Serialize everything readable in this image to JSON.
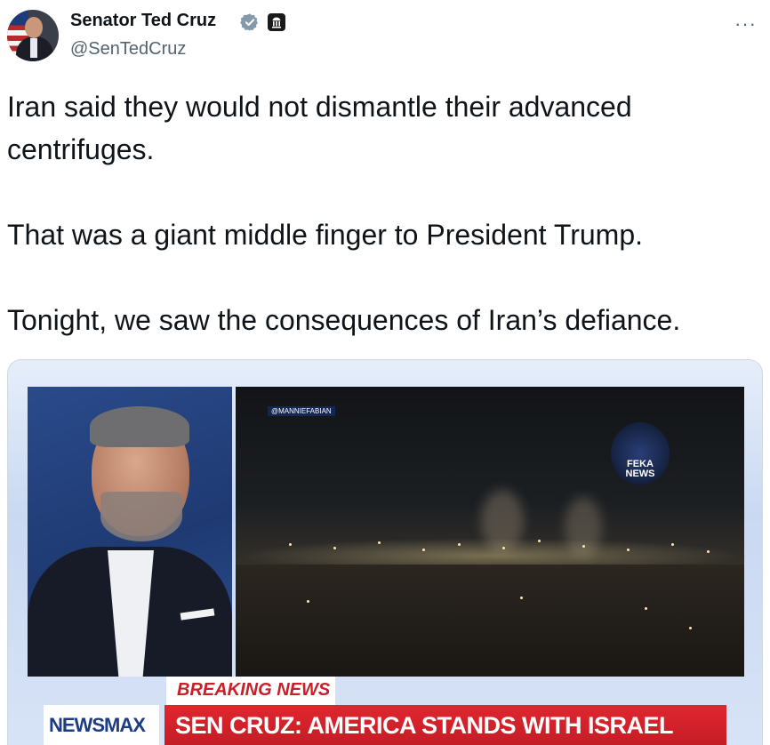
{
  "header": {
    "display_name": "Senator Ted Cruz",
    "handle": "@SenTedCruz",
    "verified_icon": "verified-badge-icon",
    "affiliation_icon": "government-building-icon",
    "more_label": "···"
  },
  "tweet": {
    "lines": [
      "Iran said they would not dismantle their advanced centrifuges.",
      "That was a giant middle finger to President Trump.",
      "Tonight, we saw the consequences of Iran’s defiance."
    ]
  },
  "media": {
    "video_credit": "@MANNIEFABIAN",
    "watermark_text": "FEKA NEWS",
    "breaking_label": "BREAKING NEWS",
    "network_logo": "NEWSMAX",
    "headline": "SEN CRUZ: AMERICA STANDS WITH ISRAEL"
  },
  "colors": {
    "text_primary": "#0f1419",
    "text_secondary": "#536471",
    "verified_fill": "#829aab",
    "breaking_red": "#c8202a",
    "ticker_red": "#d62028",
    "newsmax_blue": "#1d3c84"
  }
}
